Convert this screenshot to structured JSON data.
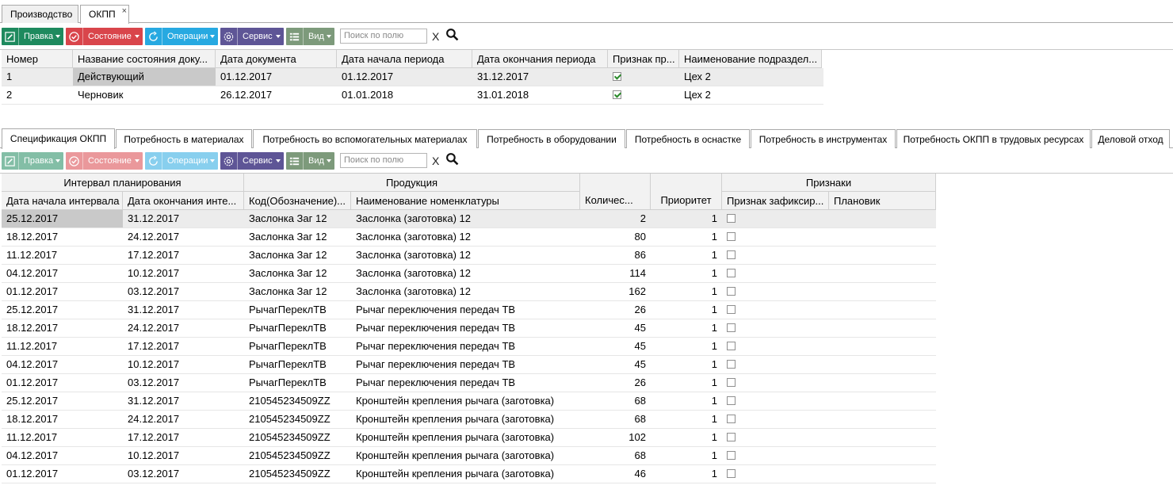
{
  "top_tabs": [
    {
      "label": "Производство"
    },
    {
      "label": "ОКПП",
      "close": "×"
    }
  ],
  "toolbar": {
    "edit": "Правка",
    "state": "Состояние",
    "operations": "Операции",
    "service": "Сервис",
    "view": "Вид",
    "search_placeholder": "Поиск по полю",
    "clear": "X"
  },
  "master_grid": {
    "columns": [
      "Номер",
      "Название состояния доку...",
      "Дата документа",
      "Дата начала периода",
      "Дата окончания периода",
      "Признак пр...",
      "Наименование подраздел..."
    ],
    "rows": [
      {
        "num": "1",
        "state": "Действующий",
        "doc_date": "01.12.2017",
        "start": "01.12.2017",
        "end": "31.12.2017",
        "flag": true,
        "dept": "Цех 2"
      },
      {
        "num": "2",
        "state": "Черновик",
        "doc_date": "26.12.2017",
        "start": "01.01.2018",
        "end": "31.01.2018",
        "flag": true,
        "dept": "Цех 2"
      }
    ]
  },
  "detail_tabs": [
    "Спецификация ОКПП",
    "Потребность в материалах",
    "Потребность во вспомогательных материалах",
    "Потребность в оборудовании",
    "Потребность в оснастке",
    "Потребность в инструментах",
    "Потребность ОКПП в трудовых ресурсах",
    "Деловой отход"
  ],
  "detail_grid": {
    "groups": {
      "interval": "Интервал планирования",
      "product": "Продукция",
      "signs": "Признаки"
    },
    "columns": [
      "Дата начала интервала",
      "Дата окончания инте...",
      "Код(Обозначение)...",
      "Наименование номенклатуры",
      "Количес...",
      "Приоритет",
      "Признак зафиксир...",
      "Плановик"
    ],
    "rows": [
      {
        "start": "25.12.2017",
        "end": "31.12.2017",
        "code": "Заслонка Заг 12",
        "name": "Заслонка (заготовка) 12",
        "qty": "2",
        "priority": "1"
      },
      {
        "start": "18.12.2017",
        "end": "24.12.2017",
        "code": "Заслонка Заг 12",
        "name": "Заслонка (заготовка) 12",
        "qty": "80",
        "priority": "1"
      },
      {
        "start": "11.12.2017",
        "end": "17.12.2017",
        "code": "Заслонка Заг 12",
        "name": "Заслонка (заготовка) 12",
        "qty": "86",
        "priority": "1"
      },
      {
        "start": "04.12.2017",
        "end": "10.12.2017",
        "code": "Заслонка Заг 12",
        "name": "Заслонка (заготовка) 12",
        "qty": "114",
        "priority": "1"
      },
      {
        "start": "01.12.2017",
        "end": "03.12.2017",
        "code": "Заслонка Заг 12",
        "name": "Заслонка (заготовка) 12",
        "qty": "162",
        "priority": "1"
      },
      {
        "start": "25.12.2017",
        "end": "31.12.2017",
        "code": "РычагПереклТВ",
        "name": "Рычаг переключения передач ТВ",
        "qty": "26",
        "priority": "1"
      },
      {
        "start": "18.12.2017",
        "end": "24.12.2017",
        "code": "РычагПереклТВ",
        "name": "Рычаг переключения передач ТВ",
        "qty": "45",
        "priority": "1"
      },
      {
        "start": "11.12.2017",
        "end": "17.12.2017",
        "code": "РычагПереклТВ",
        "name": "Рычаг переключения передач ТВ",
        "qty": "45",
        "priority": "1"
      },
      {
        "start": "04.12.2017",
        "end": "10.12.2017",
        "code": "РычагПереклТВ",
        "name": "Рычаг переключения передач ТВ",
        "qty": "45",
        "priority": "1"
      },
      {
        "start": "01.12.2017",
        "end": "03.12.2017",
        "code": "РычагПереклТВ",
        "name": "Рычаг переключения передач ТВ",
        "qty": "26",
        "priority": "1"
      },
      {
        "start": "25.12.2017",
        "end": "31.12.2017",
        "code": "210545234509ZZ",
        "name": "Кронштейн крепления рычага (заготовка)",
        "qty": "68",
        "priority": "1"
      },
      {
        "start": "18.12.2017",
        "end": "24.12.2017",
        "code": "210545234509ZZ",
        "name": "Кронштейн крепления рычага (заготовка)",
        "qty": "68",
        "priority": "1"
      },
      {
        "start": "11.12.2017",
        "end": "17.12.2017",
        "code": "210545234509ZZ",
        "name": "Кронштейн крепления рычага (заготовка)",
        "qty": "102",
        "priority": "1"
      },
      {
        "start": "04.12.2017",
        "end": "10.12.2017",
        "code": "210545234509ZZ",
        "name": "Кронштейн крепления рычага (заготовка)",
        "qty": "68",
        "priority": "1"
      },
      {
        "start": "01.12.2017",
        "end": "03.12.2017",
        "code": "210545234509ZZ",
        "name": "Кронштейн крепления рычага (заготовка)",
        "qty": "46",
        "priority": "1"
      }
    ]
  }
}
